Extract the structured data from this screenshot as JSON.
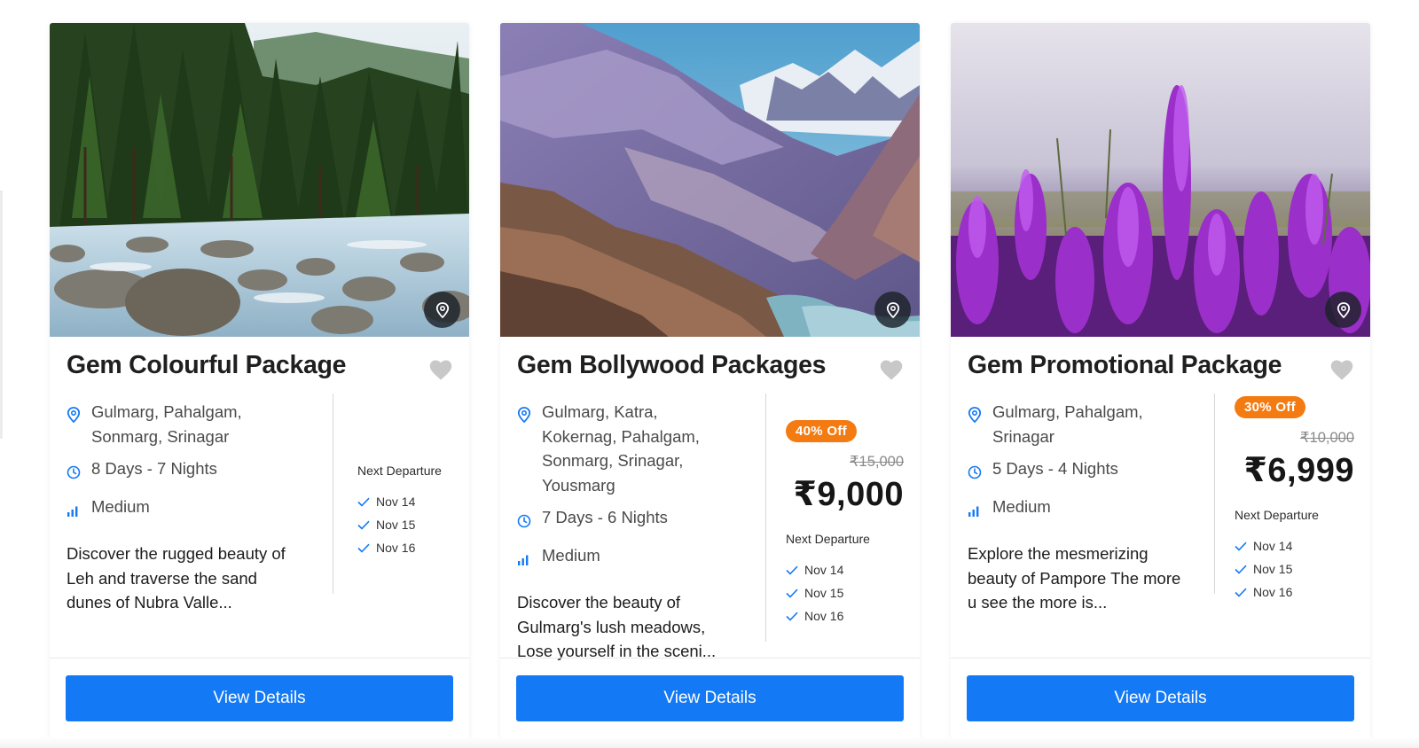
{
  "cards": [
    {
      "title": "Gem Colourful Package",
      "locations": "Gulmarg, Pahalgam, Sonmarg, Srinagar",
      "duration": "8 Days - 7 Nights",
      "difficulty": "Medium",
      "description": "Discover the rugged beauty of Leh and traverse the sand dunes of Nubra Valle...",
      "next_departure_label": "Next Departure",
      "departures": [
        "Nov 14",
        "Nov 15",
        "Nov 16"
      ],
      "button_label": "View Details",
      "image": "forest-river-photo",
      "pin_icon": "map-pin-icon",
      "favorite_icon": "heart-icon"
    },
    {
      "title": "Gem Bollywood Packages",
      "locations": "Gulmarg, Katra, Kokernag, Pahalgam, Sonmarg, Srinagar, Yousmarg",
      "duration": "7 Days - 6 Nights",
      "difficulty": "Medium",
      "description": "Discover the beauty of Gulmarg's lush meadows, Lose yourself in the sceni...",
      "discount": "40% Off",
      "old_price": "₹15,000",
      "price": "₹9,000",
      "next_departure_label": "Next Departure",
      "departures": [
        "Nov 14",
        "Nov 15",
        "Nov 16"
      ],
      "button_label": "View Details",
      "image": "mountain-valley-photo",
      "pin_icon": "map-pin-icon",
      "favorite_icon": "heart-icon"
    },
    {
      "title": "Gem Promotional Package",
      "locations": "Gulmarg, Pahalgam, Srinagar",
      "duration": "5 Days - 4 Nights",
      "difficulty": "Medium",
      "description": "Explore the mesmerizing beauty of Pampore The more u see the more is...",
      "discount": "30% Off",
      "old_price": "₹10,000",
      "price": "₹6,999",
      "next_departure_label": "Next Departure",
      "departures": [
        "Nov 14",
        "Nov 15",
        "Nov 16"
      ],
      "button_label": "View Details",
      "image": "purple-flowers-photo",
      "pin_icon": "map-pin-icon",
      "favorite_icon": "heart-icon"
    }
  ],
  "colors": {
    "primary_button": "#1479f5",
    "discount_badge": "#f47b12",
    "icon_blue": "#1479f5",
    "heart": "#c8c8c8"
  }
}
